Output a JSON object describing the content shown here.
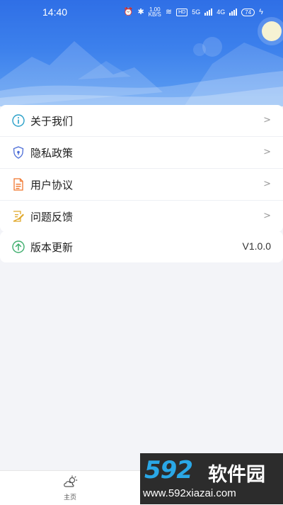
{
  "status_bar": {
    "time": "14:40",
    "speed_value": "1.00",
    "speed_unit": "KB/S",
    "hd_badge": "HD",
    "net_5g": "5G",
    "net_4g": "4G",
    "battery": "74"
  },
  "menu": {
    "items": [
      {
        "label": "关于我们",
        "icon": "info-icon",
        "color": "#2aa0c8"
      },
      {
        "label": "隐私政策",
        "icon": "shield-icon",
        "color": "#4a6bd6"
      },
      {
        "label": "用户协议",
        "icon": "document-icon",
        "color": "#f0772f"
      },
      {
        "label": "问题反馈",
        "icon": "feedback-icon",
        "color": "#e0a82a"
      }
    ],
    "update": {
      "label": "版本更新",
      "icon": "upload-arrow-icon",
      "color": "#3fae6e",
      "version": "V1.0.0"
    },
    "chevron": ">"
  },
  "bottom_nav": {
    "home_label": "主页",
    "home_icon": "weather-cloud-icon"
  },
  "watermark": {
    "digits": "592",
    "brand": "软件园",
    "url": "www.592xiazai.com"
  },
  "colors": {
    "header_top": "#2f6fe6",
    "header_bottom": "#5fa0f2",
    "background": "#f3f4f8"
  }
}
